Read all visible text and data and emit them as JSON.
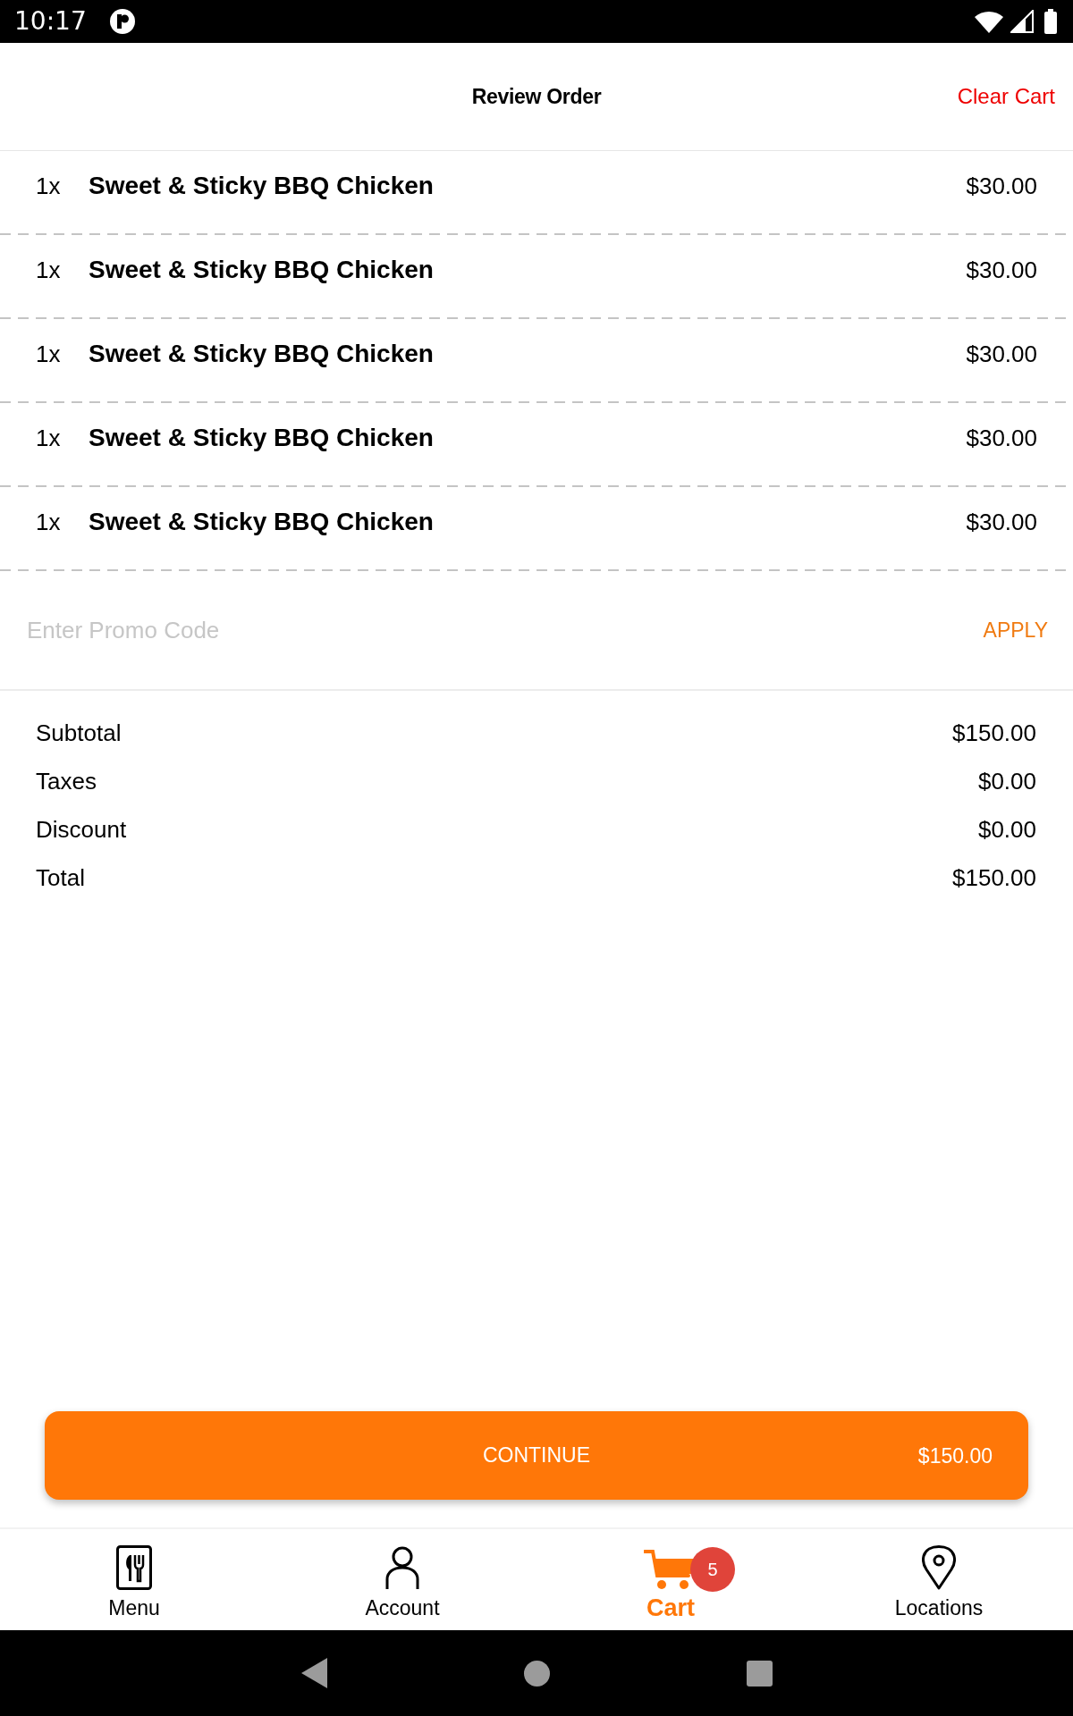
{
  "status_bar": {
    "time": "10:17"
  },
  "header": {
    "title": "Review Order",
    "action": "Clear Cart"
  },
  "items": [
    {
      "quantity": "1x",
      "name": "Sweet & Sticky BBQ Chicken",
      "price": "$30.00"
    },
    {
      "quantity": "1x",
      "name": "Sweet & Sticky BBQ Chicken",
      "price": "$30.00"
    },
    {
      "quantity": "1x",
      "name": "Sweet & Sticky BBQ Chicken",
      "price": "$30.00"
    },
    {
      "quantity": "1x",
      "name": "Sweet & Sticky BBQ Chicken",
      "price": "$30.00"
    },
    {
      "quantity": "1x",
      "name": "Sweet & Sticky BBQ Chicken",
      "price": "$30.00"
    }
  ],
  "promo": {
    "placeholder": "Enter Promo Code",
    "button": "APPLY"
  },
  "summary": [
    {
      "label": "Subtotal",
      "value": "$150.00"
    },
    {
      "label": "Taxes",
      "value": "$0.00"
    },
    {
      "label": "Discount",
      "value": "$0.00"
    },
    {
      "label": "Total",
      "value": "$150.00"
    }
  ],
  "continue_button": {
    "label": "CONTINUE",
    "amount": "$150.00"
  },
  "bottom_nav": [
    {
      "kind": "menu",
      "label": "Menu",
      "selected": false
    },
    {
      "kind": "account",
      "label": "Account",
      "selected": false
    },
    {
      "kind": "cart",
      "label": "Cart",
      "selected": true,
      "badge": "5"
    },
    {
      "kind": "locations",
      "label": "Locations",
      "selected": false
    }
  ]
}
